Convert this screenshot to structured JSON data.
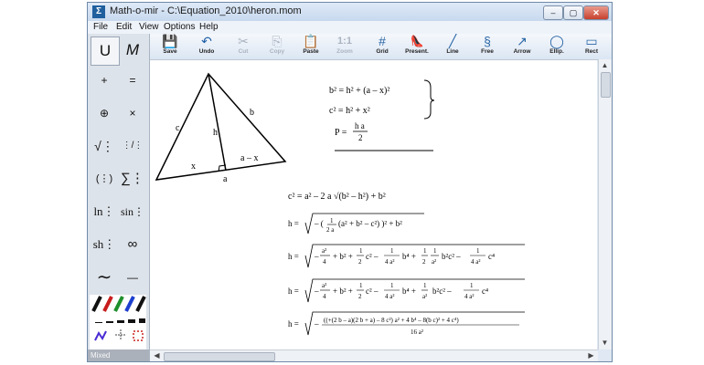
{
  "window": {
    "title": "Math-o-mir - C:\\Equation_2010\\heron.mom",
    "minimize": "–",
    "maximize": "▢",
    "close": "✕",
    "app_icon": "Σ"
  },
  "menu": [
    "File",
    "Edit",
    "View",
    "Options",
    "Help"
  ],
  "toolbar": [
    {
      "label": "Save",
      "icon": "floppy-icon",
      "glyph": "💾",
      "enabled": true
    },
    {
      "label": "Undo",
      "icon": "undo-icon",
      "glyph": "↶",
      "enabled": true
    },
    {
      "label": "Cut",
      "icon": "scissors-icon",
      "glyph": "✂",
      "enabled": false
    },
    {
      "label": "Copy",
      "icon": "copy-icon",
      "glyph": "⎘",
      "enabled": false
    },
    {
      "label": "Paste",
      "icon": "paste-icon",
      "glyph": "📋",
      "enabled": true
    },
    {
      "label": "Zoom",
      "icon": "zoom-icon",
      "glyph": "1:1",
      "enabled": false
    },
    {
      "label": "Grid",
      "icon": "grid-icon",
      "glyph": "#",
      "enabled": true
    },
    {
      "label": "Present.",
      "icon": "shoe-icon",
      "glyph": "👠",
      "enabled": true
    },
    {
      "label": "Line",
      "icon": "line-icon",
      "glyph": "╱",
      "enabled": true
    },
    {
      "label": "Free",
      "icon": "freehand-icon",
      "glyph": "§",
      "enabled": true
    },
    {
      "label": "Arrow",
      "icon": "arrow-icon",
      "glyph": "↗",
      "enabled": true
    },
    {
      "label": "Ellip.",
      "icon": "ellipse-icon",
      "glyph": "◯",
      "enabled": true
    },
    {
      "label": "Rect",
      "icon": "rect-icon",
      "glyph": "▭",
      "enabled": true
    }
  ],
  "left_panel": {
    "buttons": [
      {
        "glyph": "U",
        "name": "mode-u-button"
      },
      {
        "glyph": "M",
        "name": "mode-m-button"
      },
      {
        "glyph": "+",
        "name": "plus-button"
      },
      {
        "glyph": "=",
        "name": "equals-button"
      },
      {
        "glyph": "⊕",
        "name": "oplus-button"
      },
      {
        "glyph": "×",
        "name": "times-button"
      },
      {
        "glyph": "√⋮",
        "name": "sqrt-button"
      },
      {
        "glyph": "⋮/⋮",
        "name": "fraction-button"
      },
      {
        "glyph": "(⋮)",
        "name": "parentheses-button"
      },
      {
        "glyph": "∑⋮",
        "name": "sum-button"
      },
      {
        "glyph": "ln⋮",
        "name": "ln-button"
      },
      {
        "glyph": "sin⋮",
        "name": "sin-button"
      },
      {
        "glyph": "sh⋮",
        "name": "sh-button"
      },
      {
        "glyph": "∞",
        "name": "infinity-button"
      },
      {
        "glyph": "∼",
        "name": "curve-button"
      },
      {
        "glyph": "—",
        "name": "hline-button"
      }
    ],
    "status": "Mixed"
  },
  "canvas": {
    "triangle_labels": {
      "c": "c",
      "b": "b",
      "h": "h",
      "x": "x",
      "a": "a",
      "amx": "a – x"
    },
    "sys_eq1": "b² = h² + (a – x)²",
    "sys_eq2": "c² = h² + x²",
    "P": "P =",
    "P_num": "h a",
    "P_den": "2",
    "eq1": "c² = a² – 2 a √(b² – h²) + b²"
  }
}
